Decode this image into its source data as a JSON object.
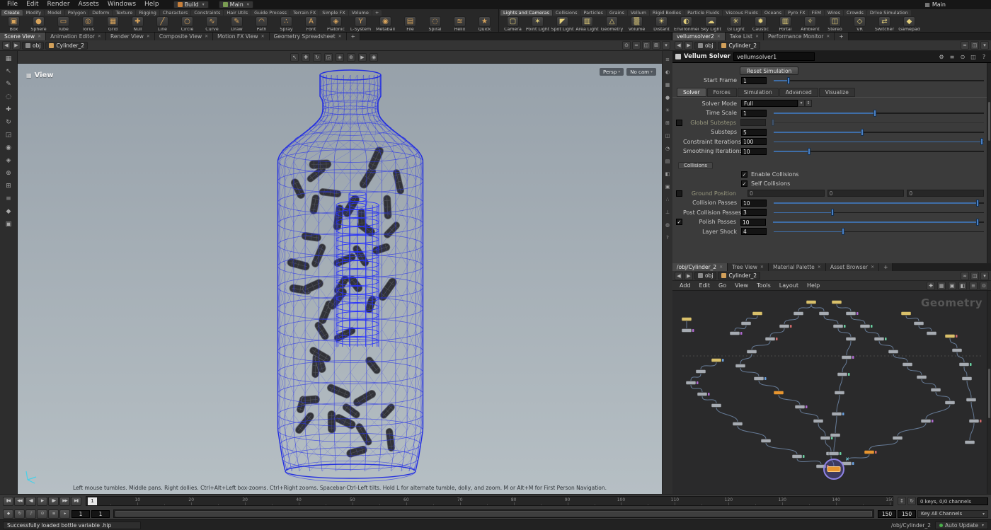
{
  "icons": {
    "caret": "▾",
    "close": "✕",
    "back": "◀",
    "forward": "▶",
    "check": "✓",
    "updown": "↕",
    "refresh": "↻",
    "grid": "▦",
    "plus": "+",
    "menu": "≡",
    "pane": "⊞"
  },
  "colors": {
    "accent_blue": "#4a80c4",
    "wire_blue": "#2a35e8",
    "selection_orange": "#e8952f"
  },
  "menubar": {
    "menus": [
      "File",
      "Edit",
      "Render",
      "Assets",
      "Windows",
      "Help"
    ],
    "desktop_label": "Build",
    "main_label": "Main",
    "right_label": "Main"
  },
  "shelf": {
    "left_tabs": [
      "Create",
      "Modify",
      "Model",
      "Polygon",
      "Deform",
      "Texture",
      "Rigging",
      "Characters",
      "Constraints",
      "Hair Utils",
      "Guide Process",
      "Terrain FX",
      "Simple FX",
      "Volume",
      "+"
    ],
    "active_left_tab": "Create",
    "left_tools": [
      {
        "label": "Box",
        "glyph": "▣"
      },
      {
        "label": "Sphere",
        "glyph": "●"
      },
      {
        "label": "Tube",
        "glyph": "▭"
      },
      {
        "label": "Torus",
        "glyph": "◎"
      },
      {
        "label": "Grid",
        "glyph": "▦"
      },
      {
        "label": "Null",
        "glyph": "✚"
      },
      {
        "label": "Line",
        "glyph": "╱"
      },
      {
        "label": "Circle",
        "glyph": "○"
      },
      {
        "label": "Curve",
        "glyph": "∿"
      },
      {
        "label": "Draw Curve",
        "glyph": "✎"
      },
      {
        "label": "Path",
        "glyph": "◠"
      },
      {
        "label": "Spray Paint",
        "glyph": "∴"
      },
      {
        "label": "Font",
        "glyph": "A"
      },
      {
        "label": "Platonic Solids",
        "glyph": "◈"
      },
      {
        "label": "L-System",
        "glyph": "Y"
      },
      {
        "label": "Metaball",
        "glyph": "◉"
      },
      {
        "label": "File",
        "glyph": "▤"
      },
      {
        "label": "Spiral",
        "glyph": "◌"
      },
      {
        "label": "Helix",
        "glyph": "≋"
      },
      {
        "label": "Quick Shapes",
        "glyph": "★"
      }
    ],
    "right_tabs": [
      "Lights and Cameras",
      "Collisions",
      "Particles",
      "Grains",
      "Vellum",
      "Rigid Bodies",
      "Particle Fluids",
      "Viscous Fluids",
      "Oceans",
      "Pyro FX",
      "FEM",
      "Wires",
      "Crowds",
      "Drive Simulation"
    ],
    "active_right_tab": "Lights and Cameras",
    "right_tools": [
      {
        "label": "Camera",
        "glyph": "▢"
      },
      {
        "label": "Point Light",
        "glyph": "✶"
      },
      {
        "label": "Spot Light",
        "glyph": "◤"
      },
      {
        "label": "Area Light",
        "glyph": "▥"
      },
      {
        "label": "Geometry Light",
        "glyph": "△"
      },
      {
        "label": "Volume Light",
        "glyph": "▒"
      },
      {
        "label": "Distant Light",
        "glyph": "☀"
      },
      {
        "label": "Environment Light",
        "glyph": "◐"
      },
      {
        "label": "Sky Light",
        "glyph": "☁"
      },
      {
        "label": "GI Light",
        "glyph": "✳"
      },
      {
        "label": "Caustic Light",
        "glyph": "✹"
      },
      {
        "label": "Portal Light",
        "glyph": "▥"
      },
      {
        "label": "Ambient Light",
        "glyph": "✧"
      },
      {
        "label": "Stereo Camera",
        "glyph": "◫"
      },
      {
        "label": "VR Camera",
        "glyph": "◇"
      },
      {
        "label": "Switcher",
        "glyph": "⇄"
      },
      {
        "label": "Gamepad Camera",
        "glyph": "◆"
      }
    ]
  },
  "left_pane": {
    "tabs": [
      "Scene View",
      "Animation Editor",
      "Render View",
      "Composite View",
      "Motion FX View",
      "Geometry Spreadsheet",
      "+"
    ],
    "active_tab": "Scene View",
    "path": {
      "root": "obj",
      "node": "Cylinder_2"
    },
    "pathbar_icons": [
      {
        "name": "pin-icon",
        "glyph": "⊙"
      },
      {
        "name": "link-icon",
        "glyph": "∞"
      },
      {
        "name": "split-pane-icon",
        "glyph": "◫"
      },
      {
        "name": "maximize-pane-icon",
        "glyph": "⊞"
      },
      {
        "name": "pane-menu-icon",
        "glyph": "▾"
      }
    ],
    "toolbar_icons": [
      {
        "name": "select-mode-icon",
        "glyph": "↖"
      },
      {
        "name": "translate-mode-icon",
        "glyph": "✚"
      },
      {
        "name": "rotate-mode-icon",
        "glyph": "↻"
      },
      {
        "name": "scale-mode-icon",
        "glyph": "◲"
      },
      {
        "name": "handles-icon",
        "glyph": "◈"
      },
      {
        "name": "snap-toggle-icon",
        "glyph": "⊕"
      },
      {
        "name": "flipbook-icon",
        "glyph": "▶"
      },
      {
        "name": "render-view-icon",
        "glyph": "◉"
      }
    ],
    "left_toolbar_icons": [
      {
        "name": "toolbox-icon",
        "glyph": "▦"
      },
      {
        "name": "select-arrow-icon",
        "glyph": "↖"
      },
      {
        "name": "paint-select-icon",
        "glyph": "✎"
      },
      {
        "name": "lasso-icon",
        "glyph": "◌"
      },
      {
        "name": "translate-icon",
        "glyph": "✚"
      },
      {
        "name": "rotate-icon",
        "glyph": "↻"
      },
      {
        "name": "scale-icon",
        "glyph": "◲"
      },
      {
        "name": "pose-icon",
        "glyph": "◉"
      },
      {
        "name": "handles-icon",
        "glyph": "◈"
      },
      {
        "name": "snap-icon",
        "glyph": "⊕"
      },
      {
        "name": "grid-snap-icon",
        "glyph": "⊞"
      },
      {
        "name": "multi-snap-icon",
        "glyph": "≡"
      },
      {
        "name": "keyframe-icon",
        "glyph": "◆"
      },
      {
        "name": "render-region-icon",
        "glyph": "▣"
      }
    ],
    "display_icons": [
      {
        "name": "view-options-icon",
        "glyph": "≡"
      },
      {
        "name": "shading-mode-icon",
        "glyph": "◐"
      },
      {
        "name": "wireframe-icon",
        "glyph": "▦"
      },
      {
        "name": "smooth-shade-icon",
        "glyph": "●"
      },
      {
        "name": "lighting-icon",
        "glyph": "☀"
      },
      {
        "name": "grid-toggle-icon",
        "glyph": "⊞"
      },
      {
        "name": "camera-lock-icon",
        "glyph": "◫"
      },
      {
        "name": "frame-view-icon",
        "glyph": "◔"
      },
      {
        "name": "group-list-icon",
        "glyph": "▤"
      },
      {
        "name": "material-icon",
        "glyph": "◧"
      },
      {
        "name": "snapshot-icon",
        "glyph": "▣"
      },
      {
        "name": "display-points-icon",
        "glyph": "∴"
      },
      {
        "name": "display-normals-icon",
        "glyph": "⊥"
      },
      {
        "name": "visualizer-icon",
        "glyph": "◍"
      },
      {
        "name": "viewport-help-icon",
        "glyph": "?"
      }
    ],
    "viewport": {
      "label": "View",
      "persp": "Persp",
      "cam": "No cam",
      "help_text": "Left mouse tumbles. Middle pans. Right dollies. Ctrl+Alt+Left box-zooms. Ctrl+Right zooms. Spacebar-Ctrl-Left tilts. Hold L for alternate tumble, dolly, and zoom. M or Alt+M for First Person Navigation."
    }
  },
  "right_pane": {
    "tabs": [
      "vellumsolver2",
      "Take List",
      "Performance Monitor",
      "+"
    ],
    "active_tab": "vellumsolver2",
    "path": {
      "root": "obj",
      "node": "Cylinder_2"
    },
    "pathbar_icons": [
      {
        "name": "link-icon",
        "glyph": "∞"
      },
      {
        "name": "split-pane-icon",
        "glyph": "◫"
      },
      {
        "name": "pane-menu-icon",
        "glyph": "▾"
      }
    ],
    "params": {
      "node_type": "Vellum Solver",
      "node_name": "vellumsolver1",
      "header_icons": [
        {
          "name": "gear-icon",
          "glyph": "⚙"
        },
        {
          "name": "sliders-icon",
          "glyph": "≡"
        },
        {
          "name": "pin-icon",
          "glyph": "⊙"
        },
        {
          "name": "lock-icon",
          "glyph": "◫"
        },
        {
          "name": "help-icon",
          "glyph": "?"
        }
      ],
      "reset_button": "Reset Simulation",
      "start_frame": {
        "label": "Start Frame",
        "type": "slider",
        "value": "1",
        "pos": 0.07
      },
      "tabs": [
        "Solver",
        "Forces",
        "Simulation",
        "Advanced",
        "Visualize"
      ],
      "active_tab": "Solver",
      "rows": [
        {
          "label": "Solver Mode",
          "type": "select",
          "value": "Full"
        },
        {
          "label": "Time Scale",
          "type": "slider",
          "value": "1",
          "pos": 0.48
        },
        {
          "label": "Global Substeps",
          "type": "slider",
          "value": "",
          "pos": 0,
          "disabled": true,
          "pre_checkbox": false
        },
        {
          "label": "Substeps",
          "type": "slider",
          "value": "5",
          "pos": 0.42
        },
        {
          "label": "Constraint Iterations",
          "type": "slider",
          "value": "100",
          "pos": 0.99
        },
        {
          "label": "Smoothing Iterations",
          "type": "slider",
          "value": "10",
          "pos": 0.17
        }
      ],
      "collisions": {
        "label": "Collisions",
        "rows": [
          {
            "label": "Enable Collisions",
            "type": "checkbox",
            "checked": true
          },
          {
            "label": "Self Collisions",
            "type": "checkbox",
            "checked": true
          },
          {
            "label": "Ground Position",
            "type": "triple",
            "values": [
              "0",
              "0",
              "0"
            ],
            "disabled": true,
            "pre_checkbox": false
          },
          {
            "label": "Collision Passes",
            "type": "slider",
            "value": "10",
            "pos": 0.97
          },
          {
            "label": "Post Collision Passes",
            "type": "slider",
            "value": "3",
            "pos": 0.28
          },
          {
            "label": "Polish Passes",
            "type": "slider",
            "value": "10",
            "pos": 0.97,
            "pre_checkbox": true
          },
          {
            "label": "Layer Shock",
            "type": "slider",
            "value": "4",
            "pos": 0.33
          }
        ]
      }
    }
  },
  "network_pane": {
    "tabs": [
      "/obj/Cylinder_2",
      "Tree View",
      "Material Palette",
      "Asset Browser",
      "+"
    ],
    "active_tab": "/obj/Cylinder_2",
    "path": {
      "root": "obj",
      "node": "Cylinder_2"
    },
    "pathbar_icons": [
      {
        "name": "link-icon",
        "glyph": "∞"
      },
      {
        "name": "split-pane-icon",
        "glyph": "◫"
      },
      {
        "name": "pane-menu-icon",
        "glyph": "▾"
      }
    ],
    "menus": [
      "Add",
      "Edit",
      "Go",
      "View",
      "Tools",
      "Layout",
      "Help"
    ],
    "toolbar_icons": [
      {
        "name": "pin-icon",
        "glyph": "✚"
      },
      {
        "name": "grid-snap-icon",
        "glyph": "▦"
      },
      {
        "name": "display-flags-icon",
        "glyph": "▣"
      },
      {
        "name": "color-palette-icon",
        "glyph": "◧"
      },
      {
        "name": "layout-nodes-icon",
        "glyph": "≡"
      },
      {
        "name": "search-icon",
        "glyph": "⊙"
      }
    ],
    "watermark": "Geometry"
  },
  "playbar": {
    "transport": [
      {
        "name": "go-to-start-button",
        "glyph": "▮◀"
      },
      {
        "name": "previous-key-button",
        "glyph": "◀◀"
      },
      {
        "name": "previous-frame-button",
        "glyph": "◀▮"
      },
      {
        "name": "play-button",
        "glyph": "▶"
      },
      {
        "name": "next-frame-button",
        "glyph": "▮▶"
      },
      {
        "name": "next-key-button",
        "glyph": "▶▶"
      },
      {
        "name": "go-to-end-button",
        "glyph": "▶▮"
      }
    ],
    "toggles": [
      {
        "name": "auto-key-icon",
        "glyph": "◆"
      },
      {
        "name": "sync-icon",
        "glyph": "↻"
      },
      {
        "name": "audio-icon",
        "glyph": "♪"
      },
      {
        "name": "realtime-toggle-icon",
        "glyph": "⊙"
      },
      {
        "name": "playback-options-icon",
        "glyph": "≡"
      },
      {
        "name": "step-options-icon",
        "glyph": "▸"
      }
    ],
    "frame": "1",
    "ruler_labels": [
      10,
      20,
      30,
      40,
      50,
      60,
      70,
      80,
      90,
      100,
      110,
      120,
      130,
      140,
      150
    ],
    "range": {
      "start": "1",
      "sub_start": "1",
      "sub_end": "150",
      "end": "150"
    },
    "keys_info": "0 keys, 0/0 channels",
    "key_all_label": "Key All Channels"
  },
  "statusbar": {
    "message": "Successfully loaded bottle variable .hip",
    "node_path": "/obj/Cylinder_2",
    "auto_update_label": "Auto Update"
  }
}
